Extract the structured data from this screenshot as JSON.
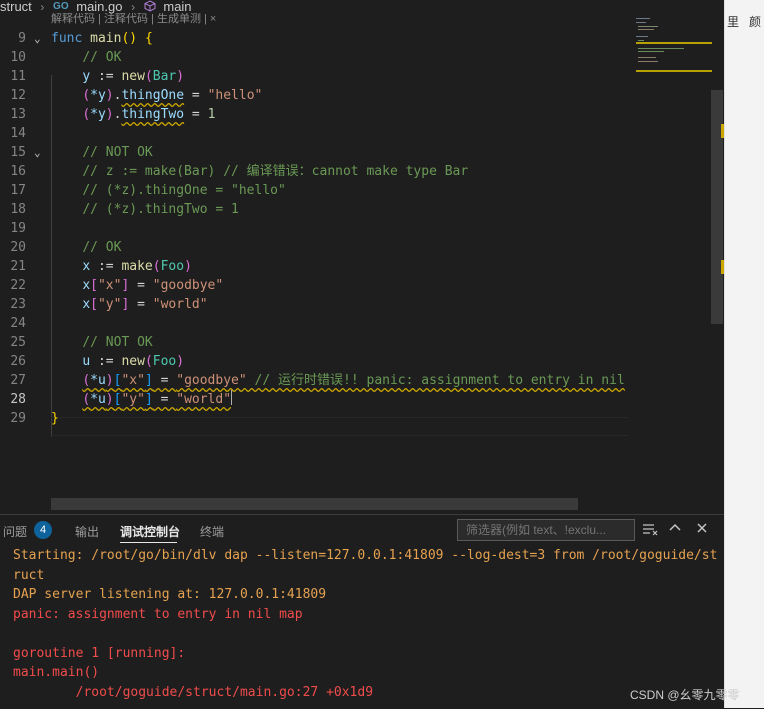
{
  "breadcrumb": {
    "folder": "struct",
    "file": "main.go",
    "file_icon": "GO",
    "symbol": "main"
  },
  "codelens": "解释代码 | 注释代码 | 生成单测 | ×",
  "editor": {
    "current_line": "28",
    "lines": [
      {
        "n": "9",
        "fold": "⌄",
        "tokens": [
          {
            "t": "func",
            "c": "kw"
          },
          {
            "t": " "
          },
          {
            "t": "main",
            "c": "fn"
          },
          {
            "t": "()",
            "c": "br1"
          },
          {
            "t": " "
          },
          {
            "t": "{",
            "c": "br1"
          }
        ]
      },
      {
        "n": "10",
        "tokens": [
          {
            "t": "    "
          },
          {
            "t": "// OK",
            "c": "cm"
          }
        ]
      },
      {
        "n": "11",
        "tokens": [
          {
            "t": "    "
          },
          {
            "t": "y",
            "c": "va"
          },
          {
            "t": " := "
          },
          {
            "t": "new",
            "c": "fn"
          },
          {
            "t": "(",
            "c": "br2"
          },
          {
            "t": "Bar",
            "c": "ty"
          },
          {
            "t": ")",
            "c": "br2"
          }
        ]
      },
      {
        "n": "12",
        "tokens": [
          {
            "t": "    "
          },
          {
            "t": "(",
            "c": "br2"
          },
          {
            "t": "*y",
            "c": "va"
          },
          {
            "t": ")",
            "c": "br2"
          },
          {
            "t": "."
          },
          {
            "t": "thingOne",
            "c": "va sq"
          },
          {
            "t": " = "
          },
          {
            "t": "\"hello\"",
            "c": "st"
          }
        ]
      },
      {
        "n": "13",
        "tokens": [
          {
            "t": "    "
          },
          {
            "t": "(",
            "c": "br2"
          },
          {
            "t": "*y",
            "c": "va"
          },
          {
            "t": ")",
            "c": "br2"
          },
          {
            "t": "."
          },
          {
            "t": "thingTwo",
            "c": "va sq"
          },
          {
            "t": " = "
          },
          {
            "t": "1",
            "c": "nu"
          }
        ]
      },
      {
        "n": "14",
        "tokens": []
      },
      {
        "n": "15",
        "fold": "⌄",
        "tokens": [
          {
            "t": "    "
          },
          {
            "t": "// NOT OK",
            "c": "cm"
          }
        ]
      },
      {
        "n": "16",
        "tokens": [
          {
            "t": "    "
          },
          {
            "t": "// z := make(Bar) // 编译错误：cannot make type Bar",
            "c": "cm"
          }
        ]
      },
      {
        "n": "17",
        "tokens": [
          {
            "t": "    "
          },
          {
            "t": "// (*z).thingOne = \"hello\"",
            "c": "cm"
          }
        ]
      },
      {
        "n": "18",
        "tokens": [
          {
            "t": "    "
          },
          {
            "t": "// (*z).thingTwo = 1",
            "c": "cm"
          }
        ]
      },
      {
        "n": "19",
        "tokens": []
      },
      {
        "n": "20",
        "tokens": [
          {
            "t": "    "
          },
          {
            "t": "// OK",
            "c": "cm"
          }
        ]
      },
      {
        "n": "21",
        "tokens": [
          {
            "t": "    "
          },
          {
            "t": "x",
            "c": "va"
          },
          {
            "t": " := "
          },
          {
            "t": "make",
            "c": "fn"
          },
          {
            "t": "(",
            "c": "br2"
          },
          {
            "t": "Foo",
            "c": "ty"
          },
          {
            "t": ")",
            "c": "br2"
          }
        ]
      },
      {
        "n": "22",
        "tokens": [
          {
            "t": "    "
          },
          {
            "t": "x",
            "c": "va"
          },
          {
            "t": "[",
            "c": "br2"
          },
          {
            "t": "\"x\"",
            "c": "st"
          },
          {
            "t": "]",
            "c": "br2"
          },
          {
            "t": " = "
          },
          {
            "t": "\"goodbye\"",
            "c": "st"
          }
        ]
      },
      {
        "n": "23",
        "tokens": [
          {
            "t": "    "
          },
          {
            "t": "x",
            "c": "va"
          },
          {
            "t": "[",
            "c": "br2"
          },
          {
            "t": "\"y\"",
            "c": "st"
          },
          {
            "t": "]",
            "c": "br2"
          },
          {
            "t": " = "
          },
          {
            "t": "\"world\"",
            "c": "st"
          }
        ]
      },
      {
        "n": "24",
        "tokens": []
      },
      {
        "n": "25",
        "tokens": [
          {
            "t": "    "
          },
          {
            "t": "// NOT OK",
            "c": "cm"
          }
        ]
      },
      {
        "n": "26",
        "tokens": [
          {
            "t": "    "
          },
          {
            "t": "u",
            "c": "va"
          },
          {
            "t": " := "
          },
          {
            "t": "new",
            "c": "fn"
          },
          {
            "t": "(",
            "c": "br2"
          },
          {
            "t": "Foo",
            "c": "ty"
          },
          {
            "t": ")",
            "c": "br2"
          }
        ]
      },
      {
        "n": "27",
        "tokens": [
          {
            "t": "    "
          },
          {
            "t": "(",
            "c": "br2 sq"
          },
          {
            "t": "*u",
            "c": "va sq"
          },
          {
            "t": ")",
            "c": "br2 sq"
          },
          {
            "t": "[",
            "c": "br3 sq"
          },
          {
            "t": "\"x\"",
            "c": "st sq"
          },
          {
            "t": "]",
            "c": "br3 sq"
          },
          {
            "t": " = ",
            "c": "sq"
          },
          {
            "t": "\"goodbye\"",
            "c": "st sq"
          },
          {
            "t": " // 运行时错误!! panic: assignment to entry in nil",
            "c": "cm sq"
          }
        ]
      },
      {
        "n": "28",
        "tokens": [
          {
            "t": "    "
          },
          {
            "t": "(",
            "c": "br2 sq"
          },
          {
            "t": "*u",
            "c": "va sq"
          },
          {
            "t": ")",
            "c": "br2 sq"
          },
          {
            "t": "[",
            "c": "br3 sq"
          },
          {
            "t": "\"y\"",
            "c": "st sq"
          },
          {
            "t": "]",
            "c": "br3 sq"
          },
          {
            "t": " = ",
            "c": "sq"
          },
          {
            "t": "\"world\"",
            "c": "st sq"
          }
        ],
        "caret": true
      },
      {
        "n": "29",
        "tokens": [
          {
            "t": "}",
            "c": "br1"
          }
        ]
      }
    ]
  },
  "right_pane": {
    "text_a": "里",
    "text_b": "颜"
  },
  "panel": {
    "tabs": [
      {
        "label": "问题",
        "badge": "4",
        "active": false
      },
      {
        "label": "输出",
        "active": false
      },
      {
        "label": "调试控制台",
        "active": true
      },
      {
        "label": "终端",
        "active": false
      }
    ],
    "filter_placeholder": "筛选器(例如 text、!exclu...",
    "console": [
      {
        "text": "Starting: /root/go/bin/dlv dap --listen=127.0.0.1:41809 --log-dest=3 from /root/goguide/st",
        "kind": "info"
      },
      {
        "text": "ruct",
        "kind": "info"
      },
      {
        "text": "DAP server listening at: 127.0.0.1:41809",
        "kind": "info"
      },
      {
        "text": "panic: assignment to entry in nil map",
        "kind": "err"
      },
      {
        "text": "",
        "kind": "info"
      },
      {
        "text": "goroutine 1 [running]:",
        "kind": "err"
      },
      {
        "text": "main.main()",
        "kind": "err"
      },
      {
        "text": "        /root/goguide/struct/main.go:27 +0x1d9",
        "kind": "err"
      }
    ]
  },
  "watermark": "CSDN @幺零九零零"
}
